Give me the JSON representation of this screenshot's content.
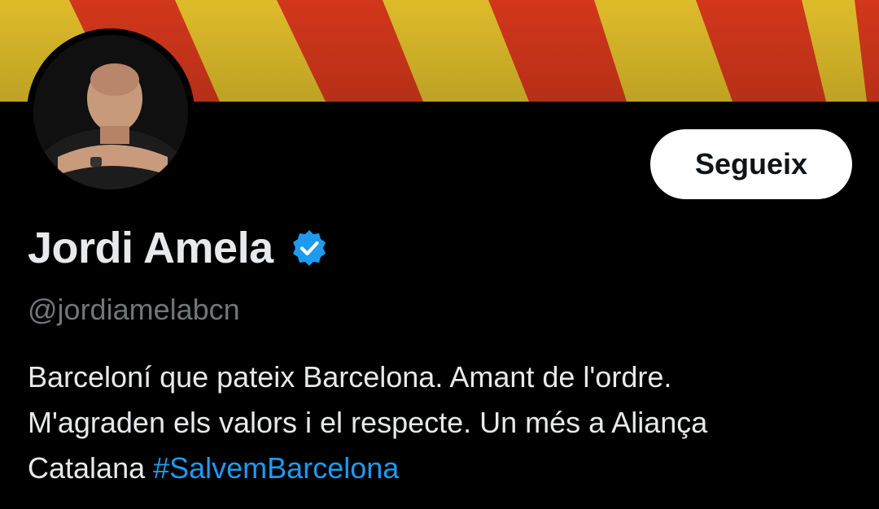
{
  "banner": {
    "description_icon": "catalan-flag-banner",
    "colors": {
      "yellow": "#e9c52c",
      "red": "#dd3a1c"
    }
  },
  "avatar": {
    "icon": "profile-photo"
  },
  "actions": {
    "follow_label": "Segueix"
  },
  "profile": {
    "display_name": "Jordi Amela",
    "verified_icon": "verified-badge-icon",
    "handle": "@jordiamelabcn"
  },
  "bio": {
    "line1": "Barceloní que pateix Barcelona. Amant de l'ordre.",
    "line2": "M'agraden els valors i el respecte. Un més a Aliança",
    "line3_text": "Catalana ",
    "hashtag": "#SalvemBarcelona"
  },
  "colors": {
    "background": "#000000",
    "text_primary": "#e7e9ea",
    "text_secondary": "#71767b",
    "accent": "#1d9bf0"
  }
}
